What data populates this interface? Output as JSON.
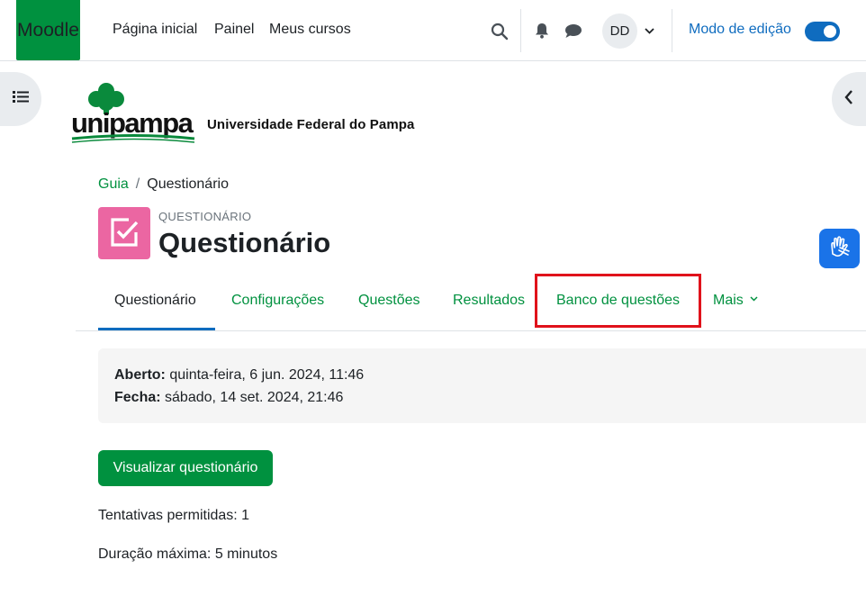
{
  "navbar": {
    "brand": "Moodle",
    "links": [
      "Página inicial",
      "Painel",
      "Meus cursos"
    ],
    "avatar_initials": "DD",
    "edit_mode_label": "Modo de edição",
    "edit_mode_on": true
  },
  "logo": {
    "wordmark": "unipampa",
    "tagline": "Universidade Federal do Pampa"
  },
  "breadcrumb": {
    "items": [
      "Guia",
      "Questionário"
    ]
  },
  "header": {
    "module_type": "QUESTIONÁRIO",
    "title": "Questionário"
  },
  "tabs": [
    {
      "label": "Questionário",
      "active": true
    },
    {
      "label": "Configurações"
    },
    {
      "label": "Questões"
    },
    {
      "label": "Resultados"
    },
    {
      "label": "Banco de questões",
      "highlighted": true
    },
    {
      "label": "Mais"
    }
  ],
  "dates": {
    "open_label": "Aberto:",
    "open_value": "quinta-feira, 6 jun. 2024, 11:46",
    "close_label": "Fecha:",
    "close_value": "sábado, 14 set. 2024, 21:46"
  },
  "actions": {
    "view_quiz": "Visualizar questionário"
  },
  "info": {
    "attempts": "Tentativas permitidas: 1",
    "duration": "Duração máxima: 5 minutos"
  },
  "colors": {
    "brand_green": "#00913f",
    "primary_blue": "#0f6cbf",
    "quiz_pink": "#eb66a2",
    "highlight_red": "#e0121b"
  }
}
